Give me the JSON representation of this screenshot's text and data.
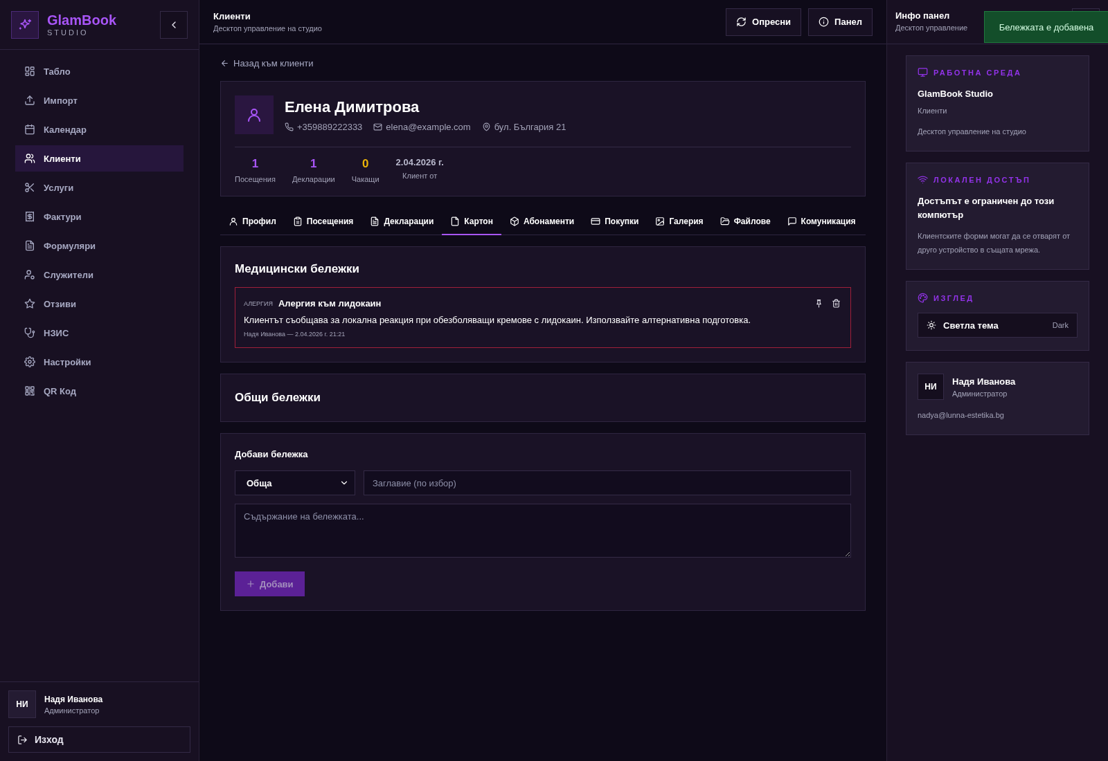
{
  "brand": {
    "name": "GlamBook",
    "subtitle": "STUDIO"
  },
  "sidebar": {
    "items": [
      {
        "label": "Табло",
        "selected": false
      },
      {
        "label": "Импорт",
        "selected": false
      },
      {
        "label": "Календар",
        "selected": false
      },
      {
        "label": "Клиенти",
        "selected": true
      },
      {
        "label": "Услуги",
        "selected": false
      },
      {
        "label": "Фактури",
        "selected": false
      },
      {
        "label": "Формуляри",
        "selected": false
      },
      {
        "label": "Служители",
        "selected": false
      },
      {
        "label": "Отзиви",
        "selected": false
      },
      {
        "label": "НЗИС",
        "selected": false
      },
      {
        "label": "Настройки",
        "selected": false
      },
      {
        "label": "QR Код",
        "selected": false
      }
    ],
    "user": {
      "initials": "НИ",
      "name": "Надя Иванова",
      "role": "Администратор"
    },
    "logout": "Изход"
  },
  "header": {
    "title": "Клиенти",
    "subtitle": "Десктоп управление на студио",
    "buttons": [
      "Опресни",
      "Панел"
    ]
  },
  "back_link": "Назад към клиенти",
  "client": {
    "name": "Елена Димитрова",
    "phone": "+359889222333",
    "email": "elena@example.com",
    "address": "бул. България 21",
    "stats": [
      {
        "value": "1",
        "label": "Посещения",
        "kind": "count"
      },
      {
        "value": "1",
        "label": "Декларации",
        "kind": "count"
      },
      {
        "value": "0",
        "label": "Чакащи",
        "kind": "pending"
      },
      {
        "value": "2.04.2026 г.",
        "label": "Клиент от",
        "kind": "date"
      }
    ]
  },
  "tabs": [
    {
      "label": "Профил",
      "selected": false
    },
    {
      "label": "Посещения",
      "selected": false
    },
    {
      "label": "Декларации",
      "selected": false
    },
    {
      "label": "Картон",
      "selected": true
    },
    {
      "label": "Абонаменти",
      "selected": false
    },
    {
      "label": "Покупки",
      "selected": false
    },
    {
      "label": "Галерия",
      "selected": false
    },
    {
      "label": "Файлове",
      "selected": false
    },
    {
      "label": "Комуникация",
      "selected": false
    }
  ],
  "medical_notes": {
    "title": "Медицински бележки",
    "notes": [
      {
        "category": "АЛЕРГИЯ",
        "title": "Алергия към лидокаин",
        "body": "Клиентът съобщава за локална реакция при обезболяващи кремове с лидокаин. Използвайте алтернативна подготовка.",
        "meta": "Надя Иванова — 2.04.2026 г. 21:21"
      }
    ]
  },
  "general_notes": {
    "title": "Общи бележки"
  },
  "add_note": {
    "title": "Добави бележка",
    "type": "Обща",
    "title_placeholder": "Заглавие (по избор)",
    "body_placeholder": "Съдържание на бележката...",
    "button": "Добави",
    "disabled": true
  },
  "info_panel": {
    "title": "Инфо панел",
    "subtitle": "Десктоп управление",
    "workspace": {
      "heading": "РАБОТНА СРЕДА",
      "title": "GlamBook Studio",
      "section": "Клиенти",
      "description": "Десктоп управление на студио"
    },
    "access": {
      "heading": "ЛОКАЛЕН ДОСТЪП",
      "title": "Достъпът е ограничен до този компютър",
      "text": "Клиентските форми могат да се отварят от друго устройство в същата мрежа."
    },
    "appearance": {
      "heading": "ИЗГЛЕД",
      "toggle_label": "Светла тема",
      "toggle_value": "Dark"
    },
    "user": {
      "initials": "НИ",
      "name": "Надя Иванова",
      "role": "Администратор",
      "email": "nadya@lunna-estetika.bg"
    }
  },
  "toast": {
    "text": "Бележката е добавена"
  }
}
